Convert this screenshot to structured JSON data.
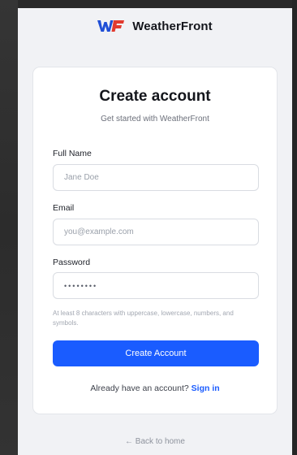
{
  "brand": {
    "logo_text": "WF",
    "name": "WeatherFront",
    "logo_colors": [
      "#1f4fd6",
      "#e23a2e"
    ]
  },
  "form": {
    "title": "Create account",
    "subtitle": "Get started with WeatherFront",
    "full_name": {
      "label": "Full Name",
      "placeholder": "Jane Doe"
    },
    "email": {
      "label": "Email",
      "placeholder": "you@example.com"
    },
    "password": {
      "label": "Password",
      "value": "••••••••"
    },
    "password_hint": "At least 8 characters with uppercase, lowercase, numbers, and symbols.",
    "submit_label": "Create Account",
    "signin_prompt": "Already have an account?",
    "signin_link": "Sign in"
  },
  "footer": {
    "back_link": "← Back to home"
  },
  "colors": {
    "accent": "#1a5cff",
    "page_bg": "#f1f2f5",
    "card_bg": "#ffffff"
  }
}
